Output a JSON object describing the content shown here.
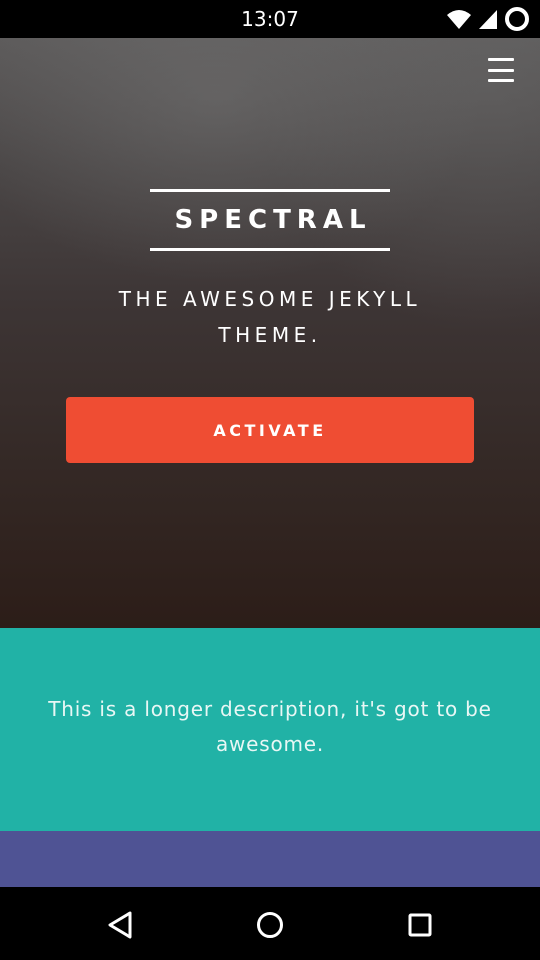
{
  "status_bar": {
    "time": "13:07",
    "icons": [
      "wifi-icon",
      "cell-signal-icon",
      "battery-ring-icon"
    ]
  },
  "hero": {
    "menu_icon": "hamburger-menu-icon",
    "title": "SPECTRAL",
    "tagline": "THE AWESOME JEKYLL THEME.",
    "cta_label": "ACTIVATE"
  },
  "description": {
    "text": "This is a longer description, it's got to be awesome."
  },
  "nav_bar": {
    "buttons": [
      "back-icon",
      "home-icon",
      "recents-icon"
    ]
  },
  "colors": {
    "accent": "#ef4d33",
    "teal": "#21b2a6",
    "purple": "#4f5394"
  }
}
